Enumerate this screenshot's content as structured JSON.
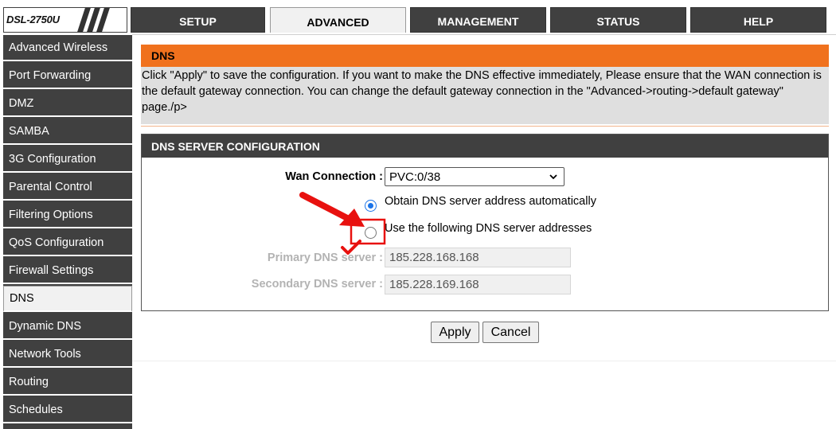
{
  "logo": {
    "text": "DSL-2750U"
  },
  "tabs": [
    {
      "label": "SETUP",
      "active": false
    },
    {
      "label": "ADVANCED",
      "active": true
    },
    {
      "label": "MANAGEMENT",
      "active": false
    },
    {
      "label": "STATUS",
      "active": false
    },
    {
      "label": "HELP",
      "active": false
    }
  ],
  "sidebar": {
    "items": [
      {
        "label": "Advanced Wireless"
      },
      {
        "label": "Port Forwarding"
      },
      {
        "label": "DMZ"
      },
      {
        "label": "SAMBA"
      },
      {
        "label": "3G Configuration"
      },
      {
        "label": "Parental Control"
      },
      {
        "label": "Filtering Options"
      },
      {
        "label": "QoS Configuration"
      },
      {
        "label": "Firewall Settings"
      },
      {
        "label": "DNS",
        "active": true
      },
      {
        "label": "Dynamic DNS"
      },
      {
        "label": "Network Tools"
      },
      {
        "label": "Routing"
      },
      {
        "label": "Schedules"
      }
    ]
  },
  "dns_info": {
    "title": "DNS",
    "text": "Click \"Apply\" to save the configuration. If you want to make the DNS effective immediately, Please ensure that the WAN connection is the default gateway connection. You can change the default gateway connection in the \"Advanced->routing->default gateway\" page./p>"
  },
  "config": {
    "title": "DNS SERVER CONFIGURATION",
    "wan_label": "Wan Connection :",
    "wan_value": "PVC:0/38",
    "radio_auto_label": "Obtain DNS server address automatically",
    "radio_manual_label": "Use the following DNS server addresses",
    "selected_mode": "auto",
    "primary_label": "Primary DNS server :",
    "primary_value": "185.228.168.168",
    "secondary_label": "Secondary DNS server :",
    "secondary_value": "185.228.169.168"
  },
  "buttons": {
    "apply": "Apply",
    "cancel": "Cancel"
  },
  "colors": {
    "accent_orange": "#f0711d",
    "dark_gray": "#404040",
    "annotation_red": "#e8110f",
    "radio_blue": "#1a73e8"
  }
}
